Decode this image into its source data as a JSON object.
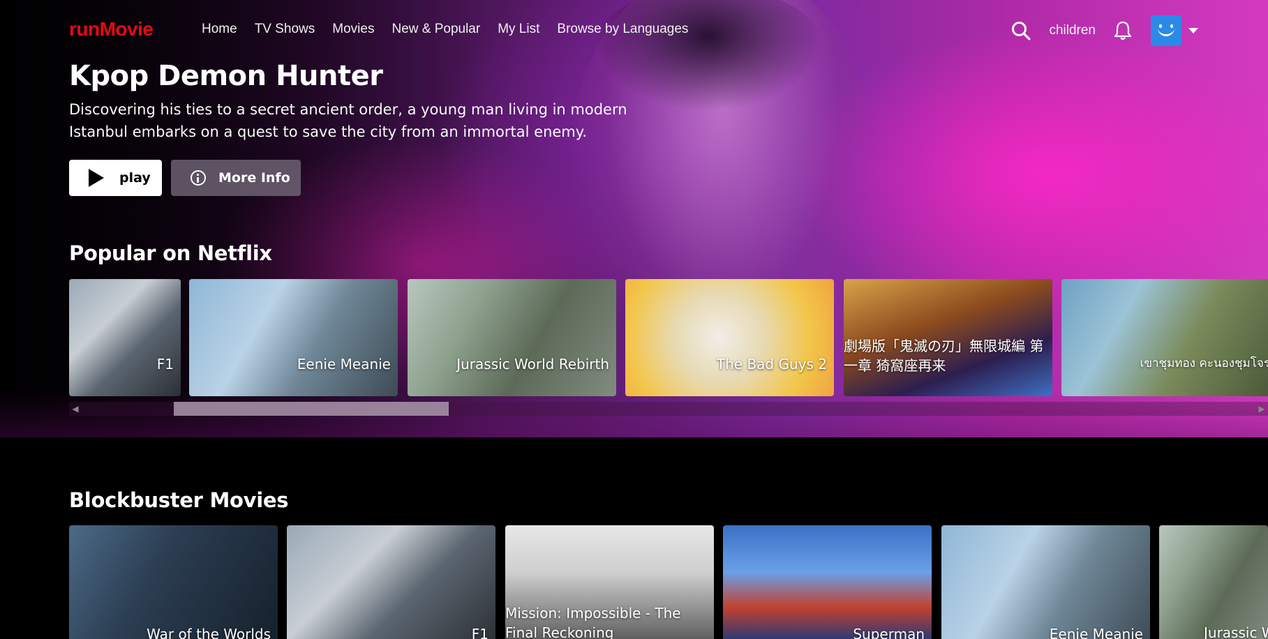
{
  "nav": {
    "logo": "runMovie",
    "links": [
      "Home",
      "TV Shows",
      "Movies",
      "New & Popular",
      "My List",
      "Browse by Languages"
    ],
    "profile_label": "children"
  },
  "hero": {
    "title": "Kpop Demon Hunter",
    "description": "Discovering his ties to a secret ancient order, a young man living in modern Istanbul embarks on a quest to save the city from an immortal enemy.",
    "play_label": "play",
    "info_label": "More Info"
  },
  "rows": [
    {
      "title": "Popular on Netflix",
      "items": [
        "F1",
        "Eenie Meanie",
        "Jurassic World Rebirth",
        "The Bad Guys 2",
        "劇場版「鬼滅の刃」無限城編 第一章 猗窩座再来",
        "เขาชุมทอง คะนองชุมโจร"
      ]
    },
    {
      "title": "Blockbuster Movies",
      "items": [
        "War of the Worlds",
        "F1",
        "Mission: Impossible - The Final Reckoning",
        "Superman",
        "Eenie Meanie",
        "Jurassic World Rebirth"
      ]
    }
  ],
  "colors": {
    "logo": "#e50914",
    "avatar": "#2b8ae8"
  },
  "icons": [
    "search-icon",
    "bell-icon",
    "play-icon",
    "info-icon",
    "caret-down-icon"
  ]
}
